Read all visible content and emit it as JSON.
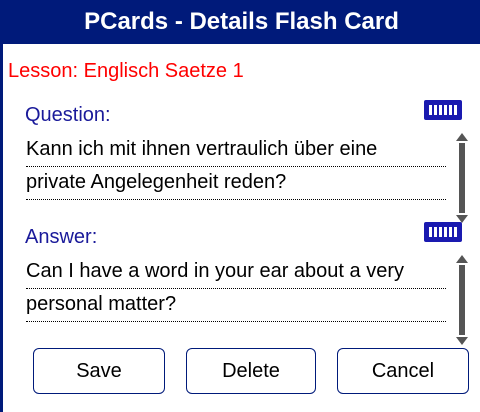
{
  "window": {
    "title": "PCards - Details Flash Card"
  },
  "lesson": {
    "label": "Lesson: Englisch Saetze 1"
  },
  "question": {
    "label": "Question:",
    "lines": [
      "Kann ich mit ihnen vertraulich über eine",
      "private Angelegenheit reden?"
    ],
    "keyboard_icon": "keyboard-icon"
  },
  "answer": {
    "label": "Answer:",
    "lines": [
      "Can I have a word in your ear about a very",
      "personal matter?"
    ],
    "keyboard_icon": "keyboard-icon"
  },
  "buttons": {
    "save": "Save",
    "delete": "Delete",
    "cancel": "Cancel"
  },
  "colors": {
    "title_bar": "#001a7a",
    "lesson_text": "#ff0000",
    "label_text": "#1a1a9a"
  }
}
